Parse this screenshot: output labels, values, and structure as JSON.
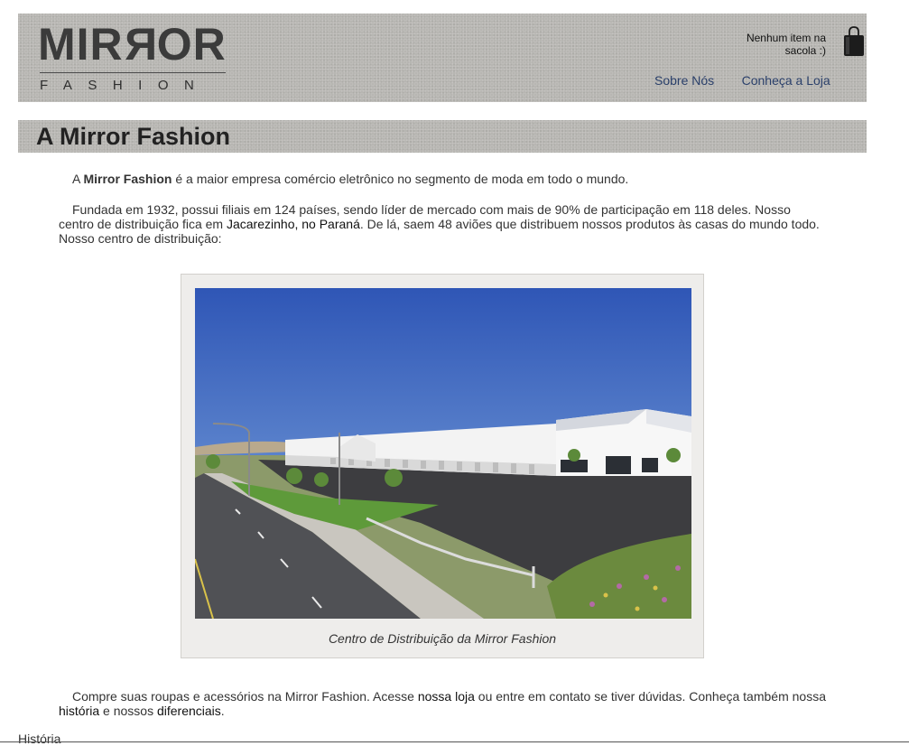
{
  "header": {
    "logo_main_parts": [
      "MIR",
      "R",
      "OR"
    ],
    "logo_sub": "FASHION",
    "cart_status": "Nenhum item na sacola :)",
    "bag_icon": "shopping-bag-icon",
    "nav": [
      {
        "label": "Sobre Nós"
      },
      {
        "label": "Conheça a Loja"
      }
    ]
  },
  "page": {
    "title": "A Mirror Fashion"
  },
  "content": {
    "p1": {
      "prefix": "A ",
      "strong": "Mirror Fashion",
      "suffix": " é a maior empresa comércio eletrônico no segmento de moda em todo o mundo."
    },
    "p2": {
      "text_a": "Fundada em 1932, possui filiais em 124 países, sendo líder de mercado com mais de 90% de participação em 118 deles. Nosso centro de distribuição fica em ",
      "place": "Jacarezinho, no Paraná",
      "text_b": ". De lá, saem 48 aviões que distribuem nossos produtos às casas do mundo todo. Nosso centro de distribuição:"
    },
    "figure": {
      "caption": "Centro de Distribuição da Mirror Fashion"
    },
    "p3": {
      "text_a": "Compre suas roupas e acessórios na Mirror Fashion. Acesse ",
      "link_store": "nossa loja",
      "text_b": " ou entre em contato se tiver dúvidas. Conheça também nossa ",
      "link_history": "história",
      "text_c": " e nossos ",
      "link_diff": "diferenciais",
      "text_d": "."
    }
  },
  "footer": {
    "link": "História"
  },
  "colors": {
    "texture_gray": "#b7b6b2",
    "nav_link": "#2a3f6a",
    "sky_top": "#2f56b6",
    "asphalt": "#3d3d40"
  }
}
